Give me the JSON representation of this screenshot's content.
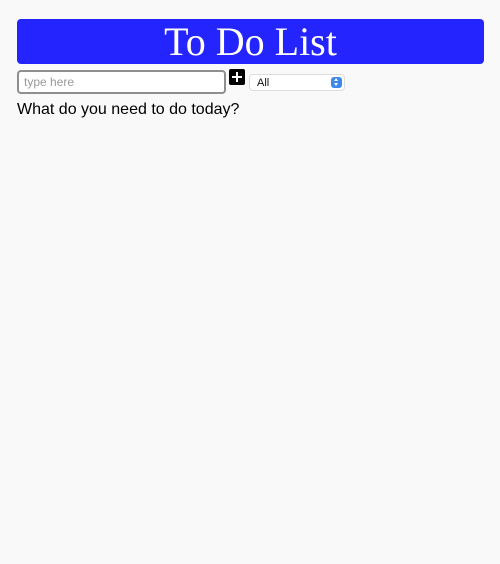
{
  "header": {
    "title": "To Do List"
  },
  "input": {
    "placeholder": "type here",
    "value": ""
  },
  "add_button": {
    "icon": "plus-icon"
  },
  "filter": {
    "selected": "All",
    "icon": "select-arrows-icon"
  },
  "prompt": "What do you need to do today?",
  "colors": {
    "header_bg": "#2424ff",
    "header_text": "#ffffff",
    "page_bg": "#f9f9f9",
    "add_button_bg": "#000000",
    "select_arrow_bg": "#3d87f0"
  }
}
